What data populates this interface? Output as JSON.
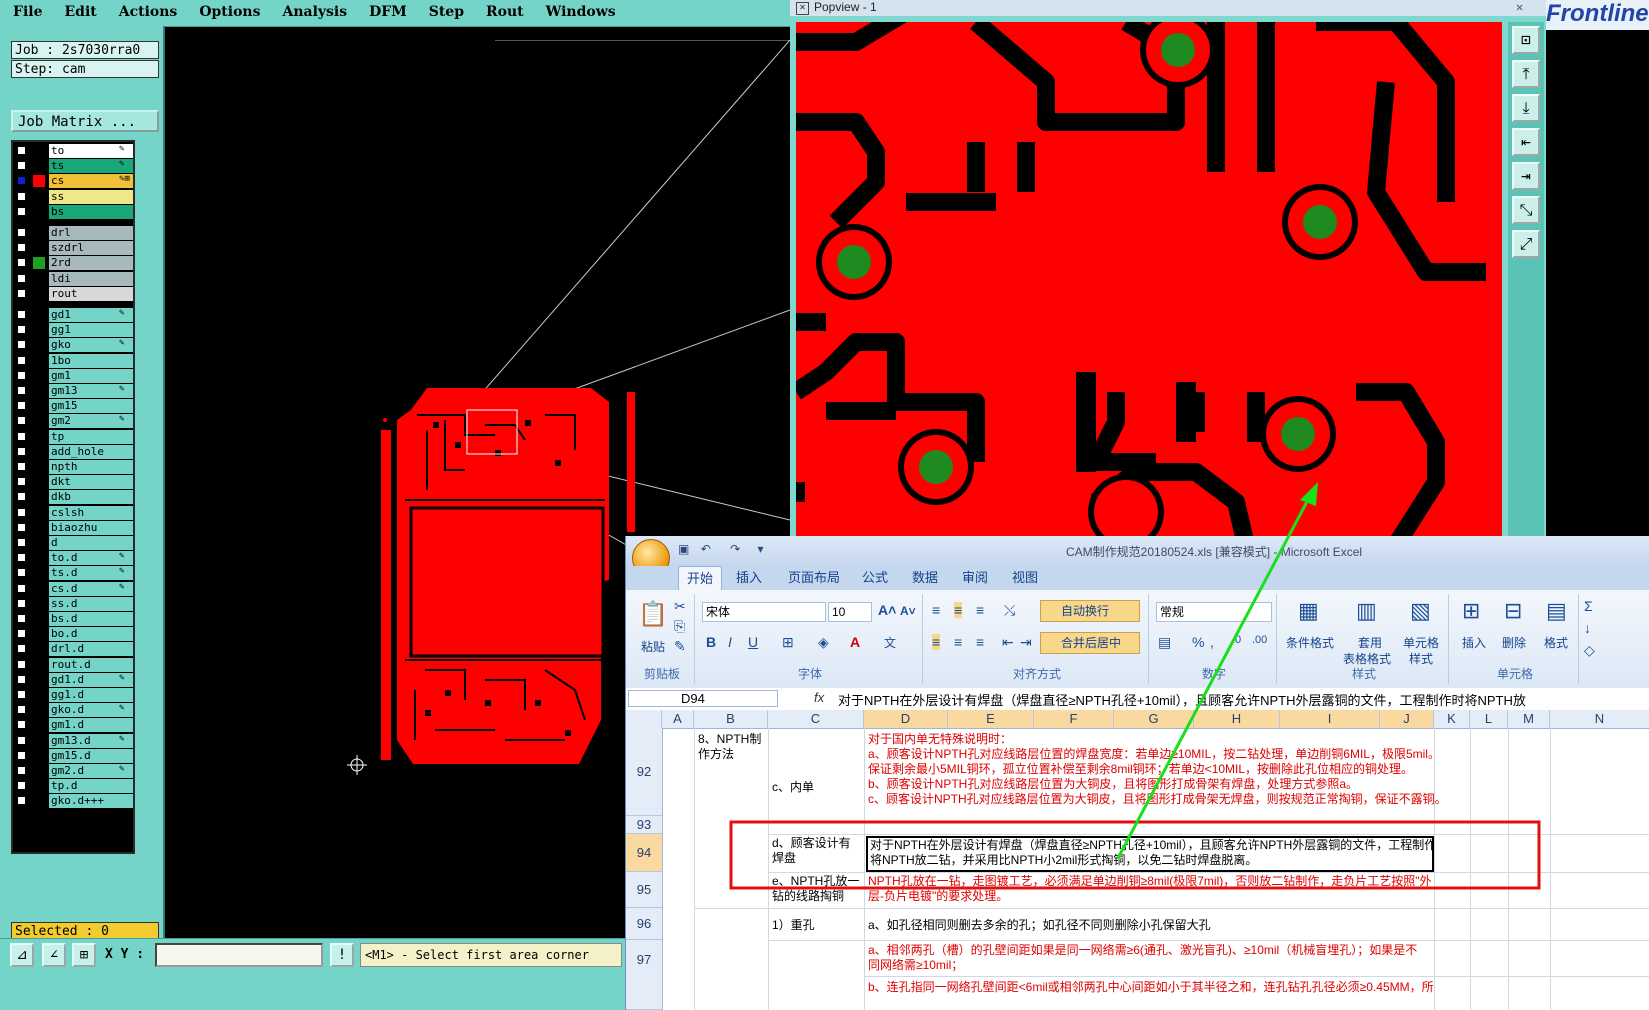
{
  "menu": [
    "File",
    "Edit",
    "Actions",
    "Options",
    "Analysis",
    "DFM",
    "Step",
    "Rout",
    "Windows"
  ],
  "job": "Job : 2s7030rra0",
  "step": "Step: cam",
  "job_matrix_label": "Job Matrix ...",
  "layers": [
    {
      "name": "to",
      "color": "#ffffff",
      "mark": "✎",
      "swatch": ""
    },
    {
      "name": "ts",
      "color": "#1aa878",
      "mark": "✎",
      "swatch": ""
    },
    {
      "name": "cs",
      "color": "#f2bf39",
      "mark": "✎⊞",
      "swatch": "#ff0000",
      "selected": true
    },
    {
      "name": "ss",
      "color": "#f0e68c",
      "mark": "",
      "swatch": ""
    },
    {
      "name": "bs",
      "color": "#1aa878",
      "mark": "",
      "swatch": ""
    },
    {
      "name": "drl",
      "color": "#a7b8bf",
      "mark": "",
      "swatch": ""
    },
    {
      "name": "szdrl",
      "color": "#a7b8bf",
      "mark": "",
      "swatch": ""
    },
    {
      "name": "2rd",
      "color": "#a7b8bf",
      "mark": "",
      "swatch": "#1ea01e"
    },
    {
      "name": "ldi",
      "color": "#a7b8bf",
      "mark": "",
      "swatch": ""
    },
    {
      "name": "rout",
      "color": "#d8d8d8",
      "mark": "",
      "swatch": ""
    },
    {
      "name": "gd1",
      "color": "#74d4c8",
      "mark": "✎",
      "swatch": ""
    },
    {
      "name": "gg1",
      "color": "#74d4c8",
      "mark": "",
      "swatch": ""
    },
    {
      "name": "gko",
      "color": "#74d4c8",
      "mark": "✎",
      "swatch": ""
    },
    {
      "name": "1bo",
      "color": "#74d4c8",
      "mark": "",
      "swatch": ""
    },
    {
      "name": "gm1",
      "color": "#74d4c8",
      "mark": "",
      "swatch": ""
    },
    {
      "name": "gm13",
      "color": "#74d4c8",
      "mark": "✎",
      "swatch": ""
    },
    {
      "name": "gm15",
      "color": "#74d4c8",
      "mark": "",
      "swatch": ""
    },
    {
      "name": "gm2",
      "color": "#74d4c8",
      "mark": "✎",
      "swatch": ""
    },
    {
      "name": "tp",
      "color": "#74d4c8",
      "mark": "",
      "swatch": ""
    },
    {
      "name": "add_hole",
      "color": "#74d4c8",
      "mark": "",
      "swatch": ""
    },
    {
      "name": "npth",
      "color": "#74d4c8",
      "mark": "",
      "swatch": ""
    },
    {
      "name": "dkt",
      "color": "#74d4c8",
      "mark": "",
      "swatch": ""
    },
    {
      "name": "dkb",
      "color": "#74d4c8",
      "mark": "",
      "swatch": ""
    },
    {
      "name": "cslsh",
      "color": "#74d4c8",
      "mark": "",
      "swatch": ""
    },
    {
      "name": "biaozhu",
      "color": "#74d4c8",
      "mark": "",
      "swatch": ""
    },
    {
      "name": "d",
      "color": "#74d4c8",
      "mark": "",
      "swatch": ""
    },
    {
      "name": "to.d",
      "color": "#74d4c8",
      "mark": "✎",
      "swatch": ""
    },
    {
      "name": "ts.d",
      "color": "#74d4c8",
      "mark": "✎",
      "swatch": ""
    },
    {
      "name": "cs.d",
      "color": "#74d4c8",
      "mark": "✎",
      "swatch": ""
    },
    {
      "name": "ss.d",
      "color": "#74d4c8",
      "mark": "",
      "swatch": ""
    },
    {
      "name": "bs.d",
      "color": "#74d4c8",
      "mark": "",
      "swatch": ""
    },
    {
      "name": "bo.d",
      "color": "#74d4c8",
      "mark": "",
      "swatch": ""
    },
    {
      "name": "drl.d",
      "color": "#74d4c8",
      "mark": "",
      "swatch": ""
    },
    {
      "name": "rout.d",
      "color": "#74d4c8",
      "mark": "",
      "swatch": ""
    },
    {
      "name": "gd1.d",
      "color": "#74d4c8",
      "mark": "✎",
      "swatch": ""
    },
    {
      "name": "gg1.d",
      "color": "#74d4c8",
      "mark": "",
      "swatch": ""
    },
    {
      "name": "gko.d",
      "color": "#74d4c8",
      "mark": "✎",
      "swatch": ""
    },
    {
      "name": "gm1.d",
      "color": "#74d4c8",
      "mark": "",
      "swatch": ""
    },
    {
      "name": "gm13.d",
      "color": "#74d4c8",
      "mark": "✎",
      "swatch": ""
    },
    {
      "name": "gm15.d",
      "color": "#74d4c8",
      "mark": "",
      "swatch": ""
    },
    {
      "name": "gm2.d",
      "color": "#74d4c8",
      "mark": "✎",
      "swatch": ""
    },
    {
      "name": "tp.d",
      "color": "#74d4c8",
      "mark": "",
      "swatch": ""
    },
    {
      "name": "gko.d+++",
      "color": "#74d4c8",
      "mark": "",
      "swatch": ""
    }
  ],
  "selected": "Selected : 0",
  "xy_label": "X Y :",
  "xy_value": "",
  "prompt": "<M1> - Select first area corner",
  "popview_title": "Popview - 1",
  "brand": "Frontline",
  "excel": {
    "title": "CAM制作规范20180524.xls [兼容模式] - Microsoft Excel",
    "tabs": [
      "开始",
      "插入",
      "页面布局",
      "公式",
      "数据",
      "审阅",
      "视图"
    ],
    "font_name": "宋体",
    "font_size": "10",
    "number_format": "常规",
    "groups": {
      "clipboard": "剪贴板",
      "font": "字体",
      "alignment": "对齐方式",
      "number": "数字",
      "styles": "样式",
      "cells": "单元格"
    },
    "buttons": {
      "paste": "粘贴",
      "wrap": "自动换行",
      "merge": "合并后居中",
      "cond_format": "条件格式",
      "table_format_1": "套用",
      "table_format_2": "表格格式",
      "cell_style_1": "单元格",
      "cell_style_2": "样式",
      "insert": "插入",
      "delete": "删除",
      "format": "格式"
    },
    "name_box": "D94",
    "formula": "对于NPTH在外层设计有焊盘（焊盘直径≥NPTH孔径+10mil），且顾客允许NPTH外层露铜的文件，工程制作时将NPTH放",
    "columns": [
      "A",
      "B",
      "C",
      "D",
      "E",
      "F",
      "G",
      "H",
      "I",
      "J",
      "K",
      "L",
      "M",
      "N"
    ],
    "rows": [
      "92",
      "93",
      "94",
      "95",
      "96",
      "97"
    ],
    "cells": {
      "b92": "8、NPTH制作方法",
      "c92": "c、内单",
      "d92_1": "对于国内单无特殊说明时：",
      "d92_2": "a、顾客设计NPTH孔对应线路层位置的焊盘宽度：若单边≥10MIL，按二钻处理，单边削铜6MIL，极限5mil。",
      "d92_3": "保证剩余最小5MIL铜环，孤立位置补偿至剩余8mil铜环；若单边<10MIL，按删除此孔位相应的铜处理。",
      "d92_4": "b、顾客设计NPTH孔对应线路层位置为大铜皮，且将图形打成骨架有焊盘，处理方式参照a。",
      "d92_5": "c、顾客设计NPTH孔对应线路层位置为大铜皮，且将图形打成骨架无焊盘，则按规范正常掏铜，保证不露铜。",
      "c94": "d、顾客设计有焊盘",
      "d94_1": "对于NPTH在外层设计有焊盘（焊盘直径≥NPTH孔径+10mil），且顾客允许NPTH外层露铜的文件，工程制作时",
      "d94_2": "将NPTH放二钻，并采用比NPTH小2mil形式掏铜，以免二钻时焊盘脱离。",
      "c95": "e、NPTH孔放一钻的线路掏铜",
      "d95_1": "NPTH孔放在一钻，走图镀工艺，必须满足单边削铜≥8mil(极限7mil)，否则放二钻制作，走负片工艺按照\"外",
      "d95_2": "层-负片电镀\"的要求处理。",
      "c96": "1）重孔",
      "d96": "a、如孔径相同则删去多余的孔；如孔径不同则删除小孔保留大孔",
      "d97_1": "a、相邻两孔（槽）的孔壁间距如果是同一网络需≥6(通孔、激光盲孔)、≥10mil（机械盲埋孔）；如果是不",
      "d97_2": "同网络需≥10mil；",
      "d97_3": "b、连孔指同一网络孔壁间距<6mil或相邻两孔中心间距如小于其半径之和，连孔钻孔孔径必须≥0.45MM，所"
    }
  }
}
